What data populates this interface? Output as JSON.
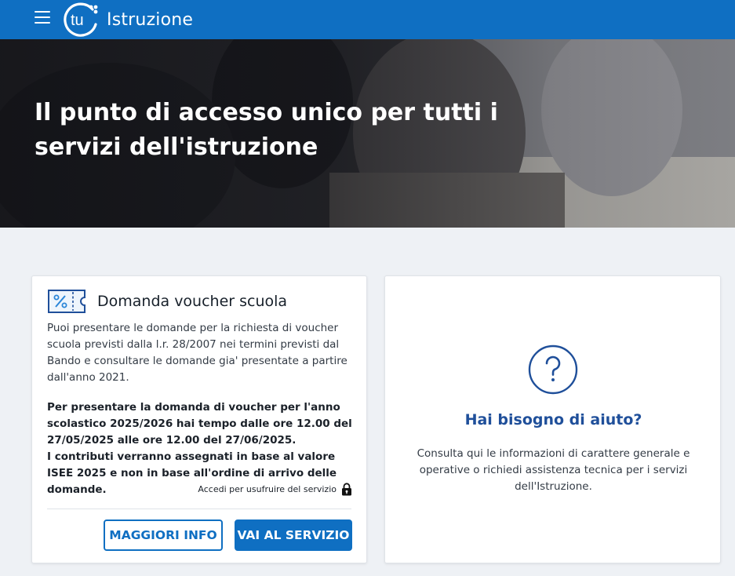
{
  "header": {
    "logo_mark": "tu",
    "app_name": "Istruzione",
    "brand_color": "#0f6fc2"
  },
  "hero": {
    "title": "Il punto di accesso unico per tutti i servizi dell'istruzione"
  },
  "voucher_card": {
    "title": "Domanda voucher scuola",
    "description": "Puoi presentare le domande per la richiesta di voucher scuola previsti dalla l.r. 28/2007 nei termini previsti dal Bando e consultare le domande gia' presentate a partire dall'anno 2021.",
    "notice_line1": "Per presentare la domanda di voucher per l'anno scolastico 2025/2026 hai tempo dalle ore 12.00 del 27/05/2025 alle ore 12.00 del 27/06/2025.",
    "notice_line2": "I contributi verranno assegnati in base al valore ISEE 2025 e non in base all'ordine di arrivo delle domande.",
    "access_note": "Accedi per usufruire del servizio",
    "more_info_label": "MAGGIORI INFO",
    "go_service_label": "VAI AL SERVIZIO",
    "icon": "voucher-percent-icon"
  },
  "help_card": {
    "title": "Hai bisogno di aiuto?",
    "text": "Consulta qui le informazioni di carattere generale e operative o richiedi assistenza tecnica per i servizi dell'Istruzione.",
    "icon": "question-circle-icon"
  }
}
